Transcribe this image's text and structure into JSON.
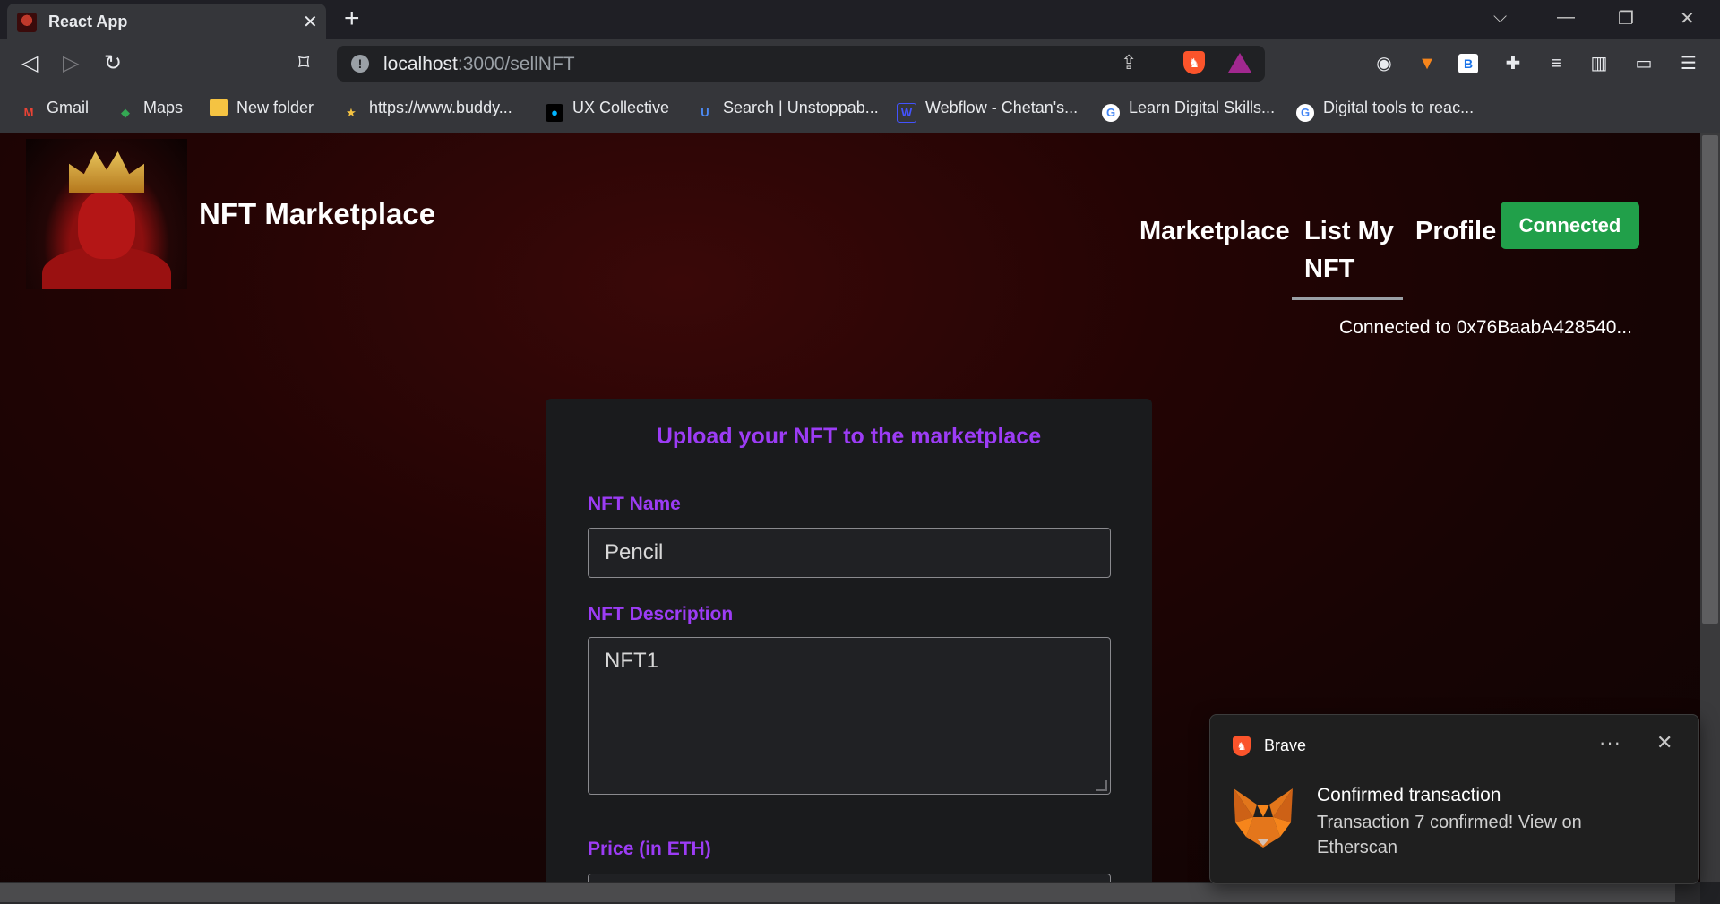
{
  "browser": {
    "tab_title": "React App",
    "url_host": "localhost",
    "url_path": ":3000/sellNFT",
    "bookmarks": [
      {
        "label": "Gmail",
        "icon": "gmail-icon"
      },
      {
        "label": "Maps",
        "icon": "maps-icon"
      },
      {
        "label": "New folder",
        "icon": "folder-icon"
      },
      {
        "label": "https://www.buddy...",
        "icon": "buddy-icon"
      },
      {
        "label": "UX Collective",
        "icon": "ux-collective-icon"
      },
      {
        "label": "Search | Unstoppab...",
        "icon": "unstoppable-icon"
      },
      {
        "label": "Webflow - Chetan's...",
        "icon": "webflow-icon"
      },
      {
        "label": "Learn Digital Skills...",
        "icon": "google-icon"
      },
      {
        "label": "Digital tools to reac...",
        "icon": "google-icon"
      }
    ]
  },
  "header": {
    "brand": "NFT Marketplace",
    "nav": {
      "marketplace": "Marketplace",
      "list_my_nft_line1": "List My",
      "list_my_nft_line2": "NFT",
      "profile": "Profile"
    },
    "connect_button": "Connected",
    "connected_to": "Connected to 0x76BaabA428540..."
  },
  "form": {
    "title": "Upload your NFT to the marketplace",
    "name_label": "NFT Name",
    "name_value": "Pencil",
    "description_label": "NFT Description",
    "description_value": "NFT1",
    "price_label": "Price (in ETH)"
  },
  "notification": {
    "app": "Brave",
    "title": "Confirmed transaction",
    "body": "Transaction 7 confirmed! View on Etherscan"
  },
  "colors": {
    "accent_purple": "#9c3cf5",
    "connect_green": "#21a04a",
    "brave_orange": "#fb542b"
  }
}
